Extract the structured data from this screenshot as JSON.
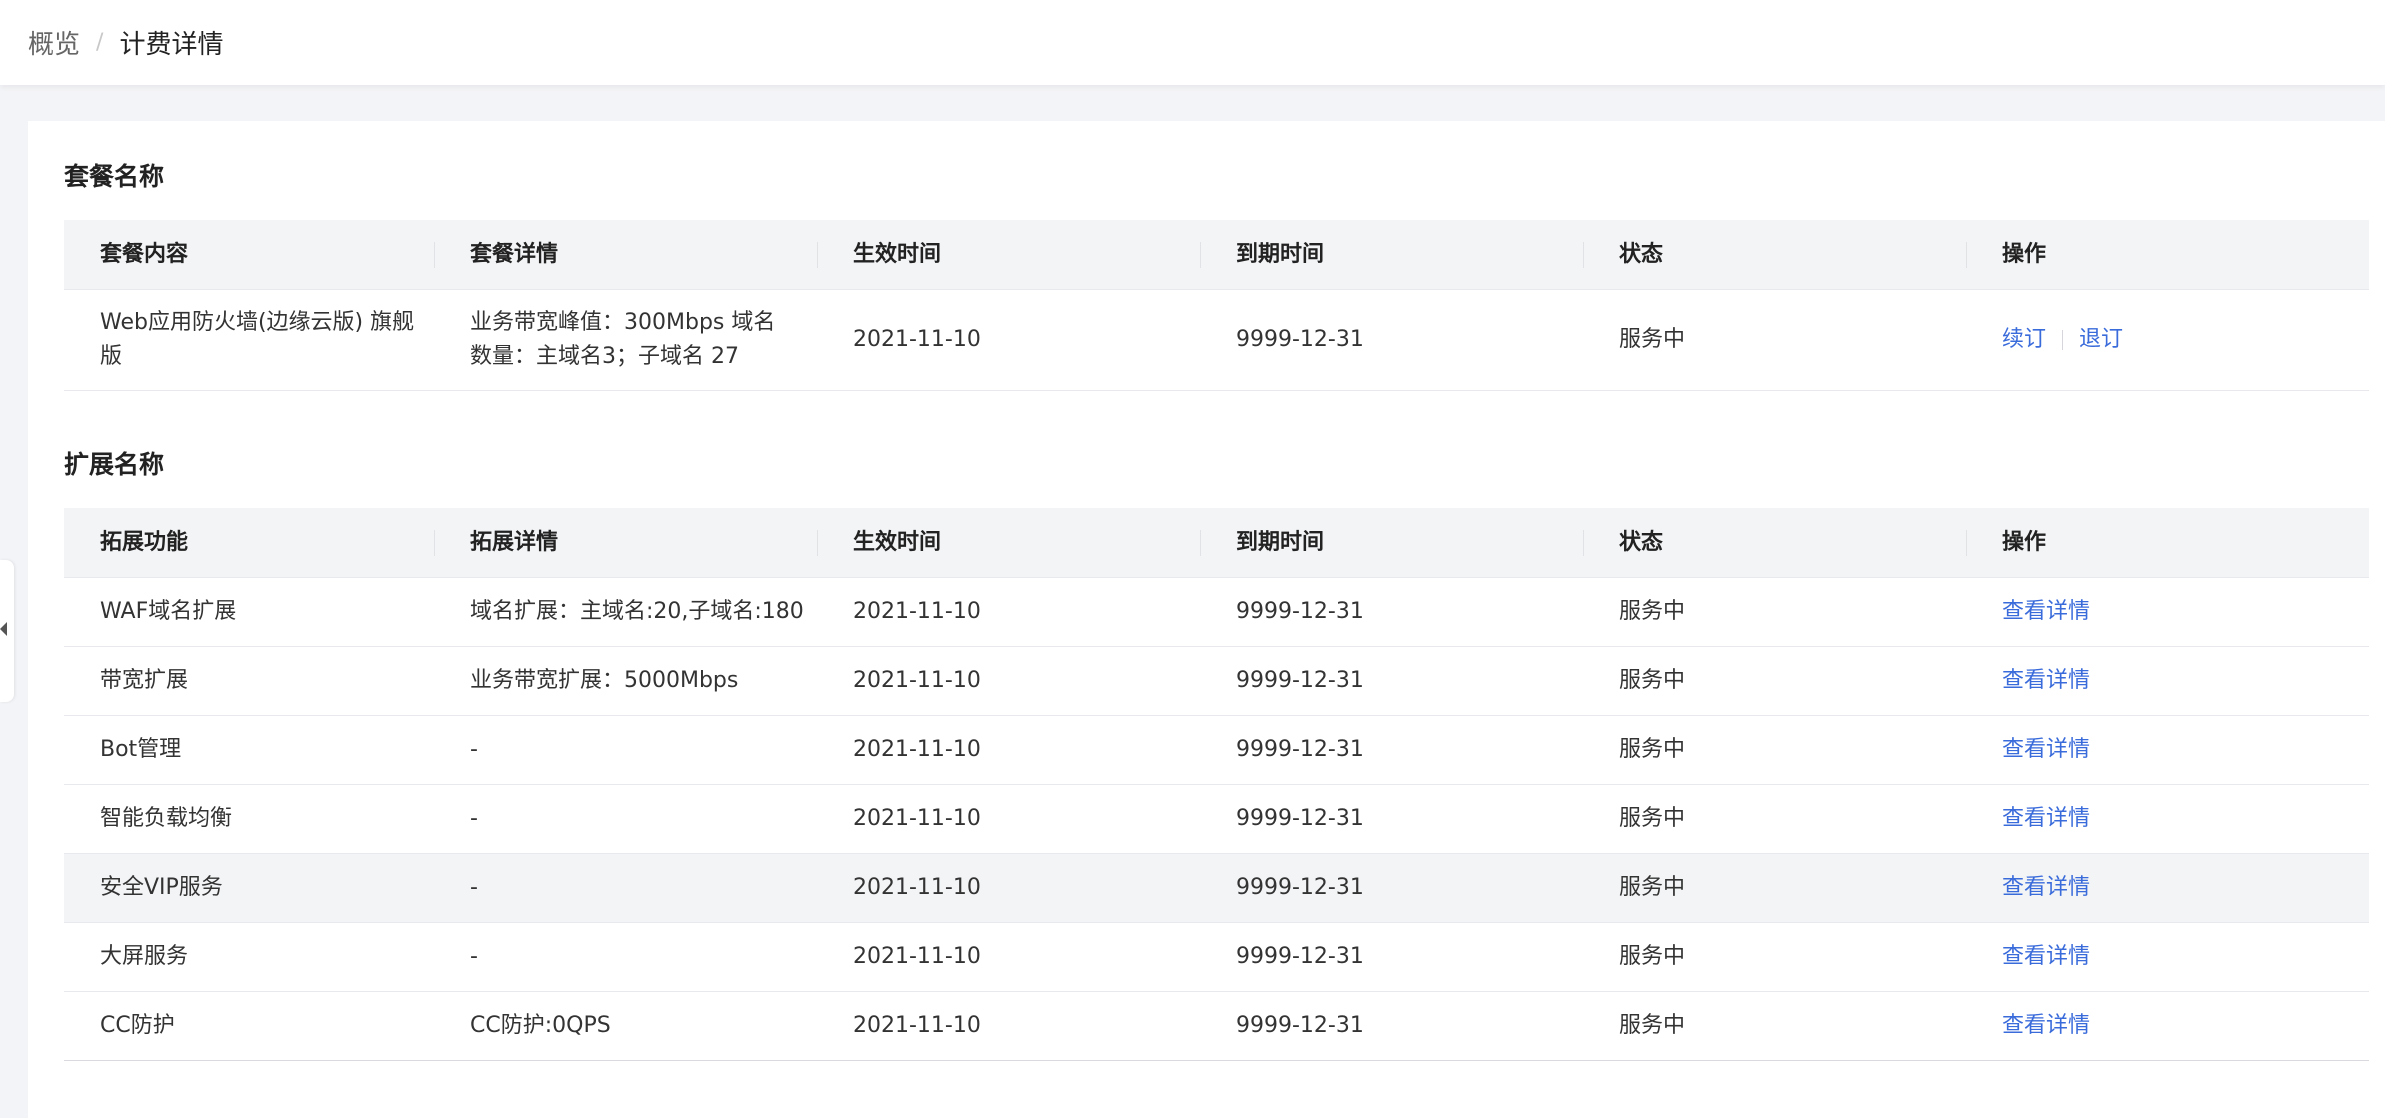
{
  "breadcrumb": {
    "root": "概览",
    "separator": "/",
    "current": "计费详情"
  },
  "package_section": {
    "title": "套餐名称",
    "headers": [
      "套餐内容",
      "套餐详情",
      "生效时间",
      "到期时间",
      "状态",
      "操作"
    ],
    "row": {
      "content": "Web应用防火墙(边缘云版) 旗舰版",
      "detail": "业务带宽峰值：300Mbps 域名数量：主域名3；子域名 27",
      "effective": "2021-11-10",
      "expire": "9999-12-31",
      "status": "服务中",
      "renew_label": "续订",
      "unsubscribe_label": "退订"
    }
  },
  "extension_section": {
    "title": "扩展名称",
    "headers": [
      "拓展功能",
      "拓展详情",
      "生效时间",
      "到期时间",
      "状态",
      "操作"
    ],
    "rows": [
      {
        "name": "WAF域名扩展",
        "detail": "域名扩展：主域名:20,子域名:180",
        "effective": "2021-11-10",
        "expire": "9999-12-31",
        "status": "服务中",
        "action": "查看详情"
      },
      {
        "name": "带宽扩展",
        "detail": "业务带宽扩展：5000Mbps",
        "effective": "2021-11-10",
        "expire": "9999-12-31",
        "status": "服务中",
        "action": "查看详情"
      },
      {
        "name": "Bot管理",
        "detail": "-",
        "effective": "2021-11-10",
        "expire": "9999-12-31",
        "status": "服务中",
        "action": "查看详情"
      },
      {
        "name": "智能负载均衡",
        "detail": "-",
        "effective": "2021-11-10",
        "expire": "9999-12-31",
        "status": "服务中",
        "action": "查看详情"
      },
      {
        "name": "安全VIP服务",
        "detail": "-",
        "effective": "2021-11-10",
        "expire": "9999-12-31",
        "status": "服务中",
        "action": "查看详情"
      },
      {
        "name": "大屏服务",
        "detail": "-",
        "effective": "2021-11-10",
        "expire": "9999-12-31",
        "status": "服务中",
        "action": "查看详情"
      },
      {
        "name": "CC防护",
        "detail": "CC防护:0QPS",
        "effective": "2021-11-10",
        "expire": "9999-12-31",
        "status": "服务中",
        "action": "查看详情"
      }
    ]
  },
  "colors": {
    "link": "#3a6bdb",
    "header_bg": "#f3f4f6",
    "page_bg": "#f3f4f7"
  }
}
